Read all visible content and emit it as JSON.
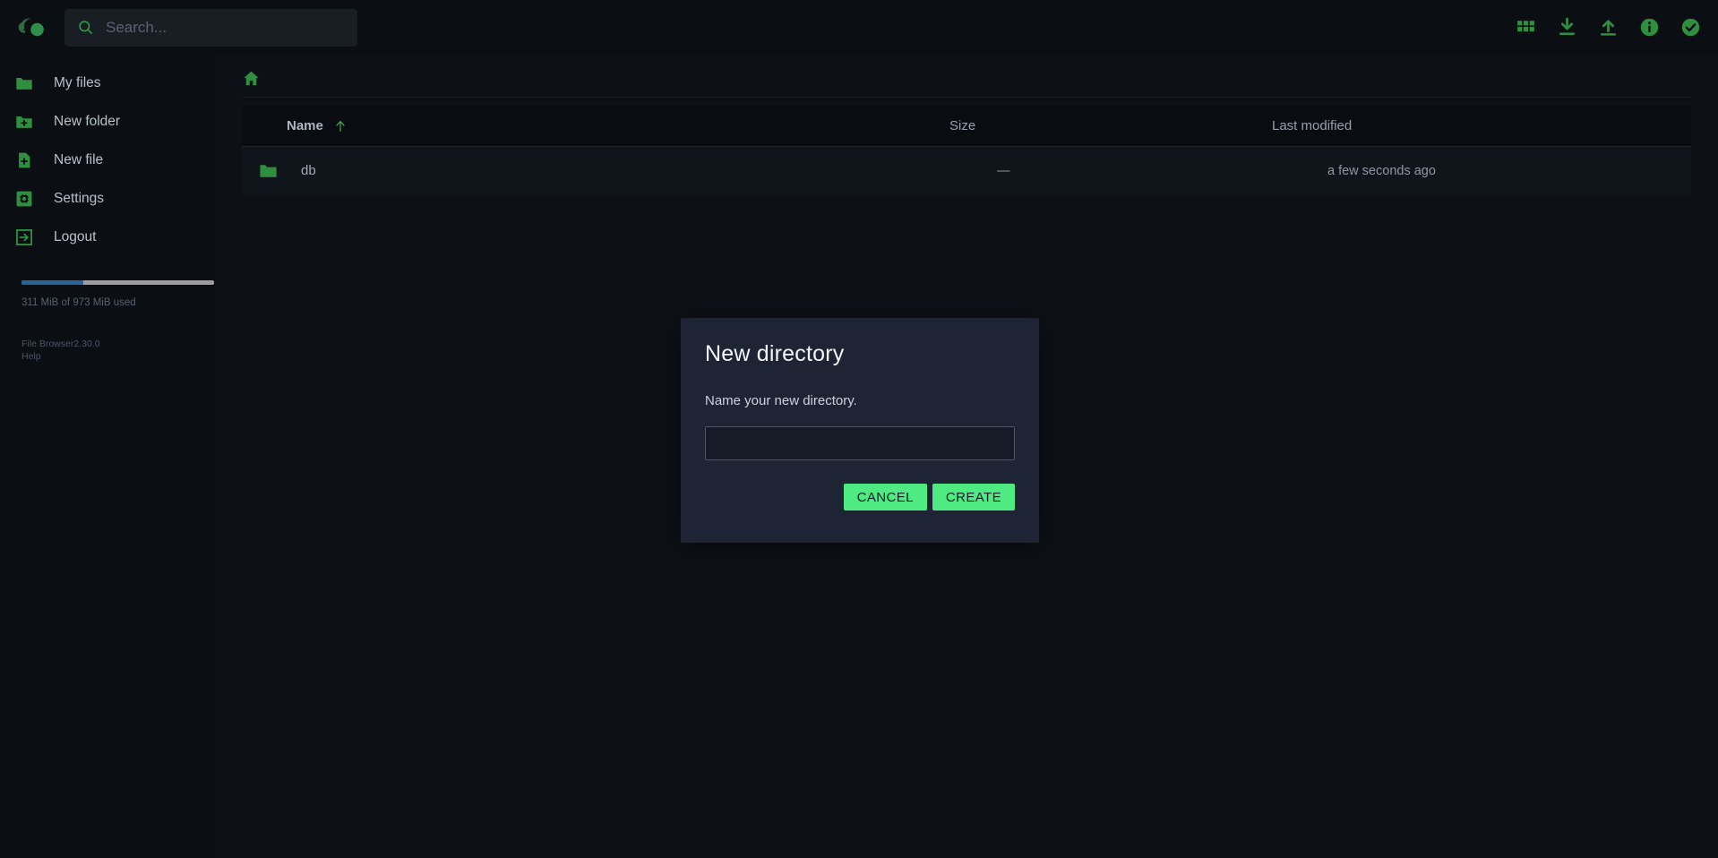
{
  "app": {
    "accent_green": "#37a04a",
    "button_green": "#4eea82",
    "background": "#0d1117",
    "sidebar_background": "#0b0f14"
  },
  "header": {
    "logo_name": "filebrowser-cloud-logo",
    "search": {
      "placeholder": "Search...",
      "value": "",
      "icon": "search-icon"
    },
    "actions": [
      {
        "name": "grid-view-icon",
        "label": "Switch view"
      },
      {
        "name": "download-icon",
        "label": "Download"
      },
      {
        "name": "upload-icon",
        "label": "Upload"
      },
      {
        "name": "info-icon",
        "label": "Info"
      },
      {
        "name": "select-multiple-icon",
        "label": "Select multiple"
      }
    ]
  },
  "sidebar": {
    "items": [
      {
        "label": "My files",
        "icon": "folder-icon"
      },
      {
        "label": "New folder",
        "icon": "folder-plus-icon"
      },
      {
        "label": "New file",
        "icon": "file-plus-icon"
      },
      {
        "label": "Settings",
        "icon": "gear-icon"
      },
      {
        "label": "Logout",
        "icon": "logout-icon"
      }
    ],
    "storage": {
      "used_percent": 32,
      "text": "311 MiB of 973 MiB used",
      "fill_color": "#2a6496",
      "track_color": "#9e9e9e"
    },
    "footer": {
      "product": "File Browser",
      "version": "2.30.0",
      "help": "Help"
    }
  },
  "breadcrumb": {
    "home_icon": "home-icon"
  },
  "file_table": {
    "columns": [
      {
        "key": "name",
        "label": "Name",
        "sorted": true,
        "sort_direction": "asc"
      },
      {
        "key": "size",
        "label": "Size"
      },
      {
        "key": "modified",
        "label": "Last modified"
      }
    ],
    "rows": [
      {
        "icon": "folder-icon",
        "name": "db",
        "size": "—",
        "modified": "a few seconds ago"
      }
    ]
  },
  "dialog": {
    "title": "New directory",
    "prompt": "Name your new directory.",
    "input": {
      "value": "",
      "placeholder": ""
    },
    "cancel_label": "CANCEL",
    "create_label": "CREATE"
  }
}
